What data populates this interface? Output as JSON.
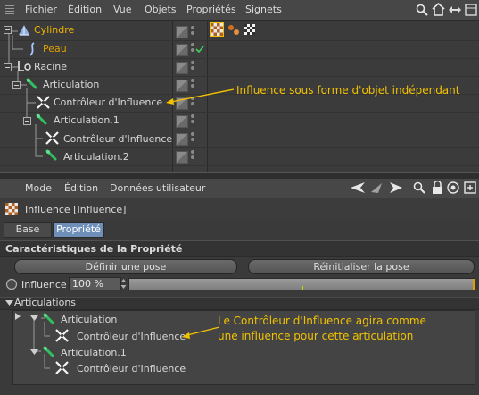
{
  "menubar": {
    "items": [
      "Fichier",
      "Édition",
      "Vue",
      "Objets",
      "Propriétés",
      "Signets"
    ],
    "icons": [
      "search-icon",
      "home-icon",
      "nav-arrows-icon",
      "layout-icon"
    ]
  },
  "tree": {
    "rows": [
      {
        "label": "Cylindre",
        "color": "#f0b400",
        "icon": "cylinder-icon"
      },
      {
        "label": "Peau",
        "color": "#e0a000",
        "icon": "skin-icon"
      },
      {
        "label": "Racine",
        "color": "#d8d8d8",
        "icon": "root-joint-icon"
      },
      {
        "label": "Articulation",
        "color": "#d8d8d8",
        "icon": "joint-icon"
      },
      {
        "label": "Contrôleur d'Influence",
        "color": "#d8d8d8",
        "icon": "weight-effector-icon"
      },
      {
        "label": "Articulation.1",
        "color": "#d8d8d8",
        "icon": "joint-icon"
      },
      {
        "label": "Contrôleur d'Influence",
        "color": "#d8d8d8",
        "icon": "weight-effector-icon"
      },
      {
        "label": "Articulation.2",
        "color": "#d8d8d8",
        "icon": "joint-icon"
      }
    ],
    "annotation": "Influence sous forme d'objet indépendant"
  },
  "attributes": {
    "toolbar": [
      "Mode",
      "Édition",
      "Données utilisateur"
    ],
    "title": "Influence [Influence]",
    "tabs": [
      "Base",
      "Propriété"
    ],
    "active_tab": "Propriété",
    "section": "Caractéristiques de la Propriété",
    "buttons": {
      "define_pose": "Définir une pose",
      "reset_pose": "Réinitialiser la pose"
    },
    "influence": {
      "label": "Influence",
      "value": "100 %",
      "fraction": 1.0
    },
    "articulations": {
      "header": "Articulations",
      "rows": [
        {
          "label": "Articulation",
          "icon": "joint-icon"
        },
        {
          "label": "Contrôleur d'Influence",
          "icon": "weight-effector-icon"
        },
        {
          "label": "Articulation.1",
          "icon": "joint-icon"
        },
        {
          "label": "Contrôleur d'Influence",
          "icon": "weight-effector-icon"
        }
      ],
      "annotation_line1": "Le Contrôleur d'Influence agira comme",
      "annotation_line2": "une influence pour cette articulation"
    }
  },
  "colors": {
    "accent": "#f2c200",
    "tab_active": "#6d8fb8"
  }
}
